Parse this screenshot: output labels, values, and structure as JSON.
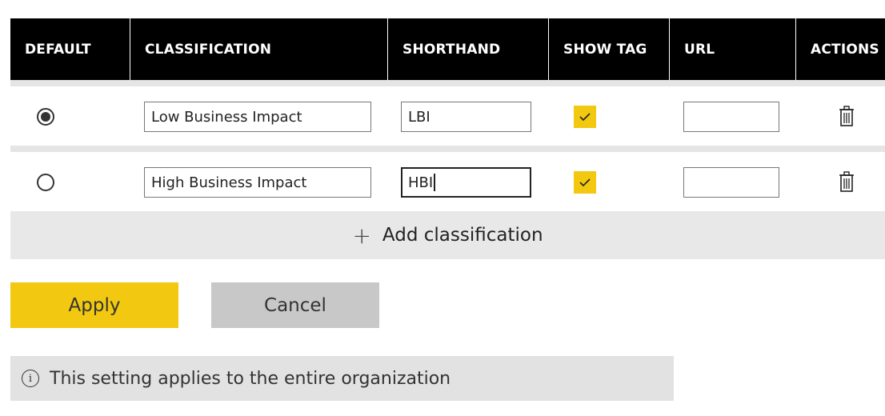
{
  "table": {
    "headers": {
      "default": "DEFAULT",
      "classification": "CLASSIFICATION",
      "shorthand": "SHORTHAND",
      "show_tag": "SHOW TAG",
      "url": "URL",
      "actions": "ACTIONS"
    },
    "rows": [
      {
        "is_default": true,
        "classification": "Low Business Impact",
        "shorthand": "LBI",
        "show_tag": true,
        "url": ""
      },
      {
        "is_default": false,
        "classification": "High Business Impact",
        "shorthand": "HBI",
        "show_tag": true,
        "url": ""
      }
    ]
  },
  "add_classification_label": "Add classification",
  "buttons": {
    "apply": "Apply",
    "cancel": "Cancel"
  },
  "info": {
    "text": "This setting applies to the entire organization",
    "icon": "info-icon"
  },
  "colors": {
    "accent": "#f2c811",
    "header_bg": "#000000",
    "bar_bg": "#e8e8e8"
  }
}
